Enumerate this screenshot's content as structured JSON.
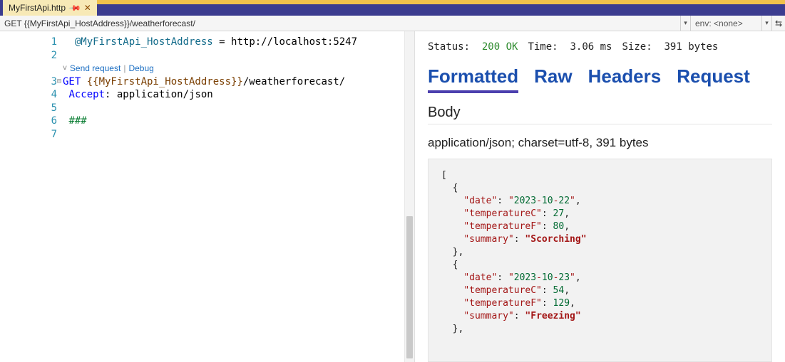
{
  "tab": {
    "title": "MyFirstApi.http",
    "pinned": true
  },
  "address": {
    "path": "GET {{MyFirstApi_HostAddress}}/weatherforecast/",
    "env_label": "env: <none>"
  },
  "editor": {
    "lines": [
      "1",
      "2",
      "3",
      "4",
      "5",
      "6",
      "7"
    ],
    "var_name": "@MyFirstApi_HostAddress",
    "var_eq": " = ",
    "var_value": "http://localhost:5247",
    "codelens": {
      "send": "Send request",
      "debug": "Debug"
    },
    "method": "GET ",
    "host_token": "{{MyFirstApi_HostAddress}}",
    "path_suffix": "/weatherforecast/",
    "header_name": "Accept",
    "header_sep": ": ",
    "header_value": "application/json",
    "divider": "###"
  },
  "response": {
    "status_label": "Status:",
    "status_value": "200 OK",
    "time_label": "Time:",
    "time_value": "3.06 ms",
    "size_label": "Size:",
    "size_value": "391 bytes",
    "tabs": {
      "formatted": "Formatted",
      "raw": "Raw",
      "headers": "Headers",
      "request": "Request"
    },
    "body_heading": "Body",
    "content_type": "application/json; charset=utf-8, 391 bytes"
  },
  "chart_data": {
    "type": "table",
    "title": "weatherforecast response (partial)",
    "columns": [
      "date",
      "temperatureC",
      "temperatureF",
      "summary"
    ],
    "rows": [
      {
        "date": "2023-10-22",
        "temperatureC": 27,
        "temperatureF": 80,
        "summary": "Scorching"
      },
      {
        "date": "2023-10-23",
        "temperatureC": 54,
        "temperatureF": 129,
        "summary": "Freezing"
      }
    ]
  }
}
